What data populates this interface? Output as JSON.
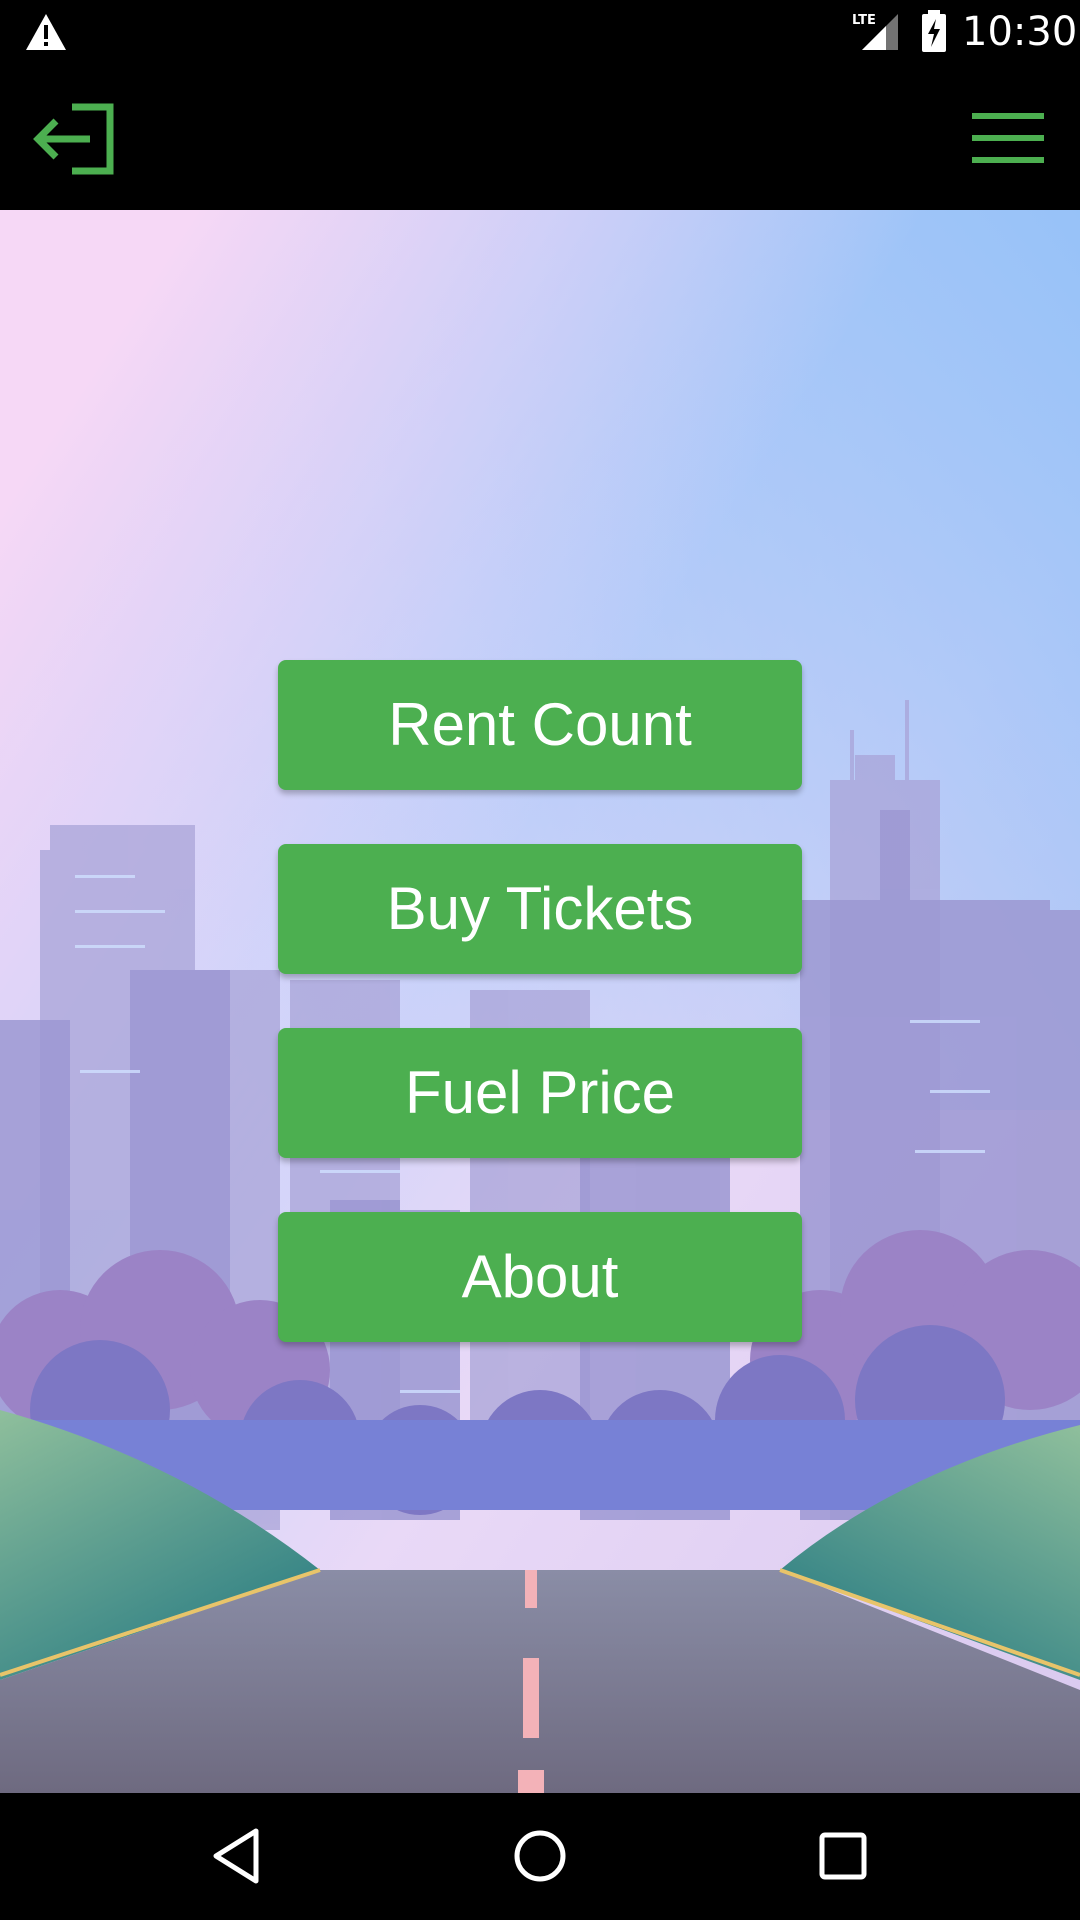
{
  "status_bar": {
    "time": "10:30",
    "network": "LTE",
    "icons": [
      "warning-icon",
      "signal-icon",
      "battery-charging-icon"
    ]
  },
  "app_bar": {
    "left_icon": "exit-icon",
    "right_icon": "hamburger-menu-icon",
    "accent_color": "#4caf50"
  },
  "menu": {
    "buttons": [
      {
        "label": "Rent Count"
      },
      {
        "label": "Buy Tickets"
      },
      {
        "label": "Fuel Price"
      },
      {
        "label": "About"
      }
    ],
    "button_color": "#4caf50",
    "text_color": "#ffffff"
  },
  "nav_bar": {
    "icons": [
      "back-icon",
      "home-icon",
      "recents-icon"
    ]
  }
}
